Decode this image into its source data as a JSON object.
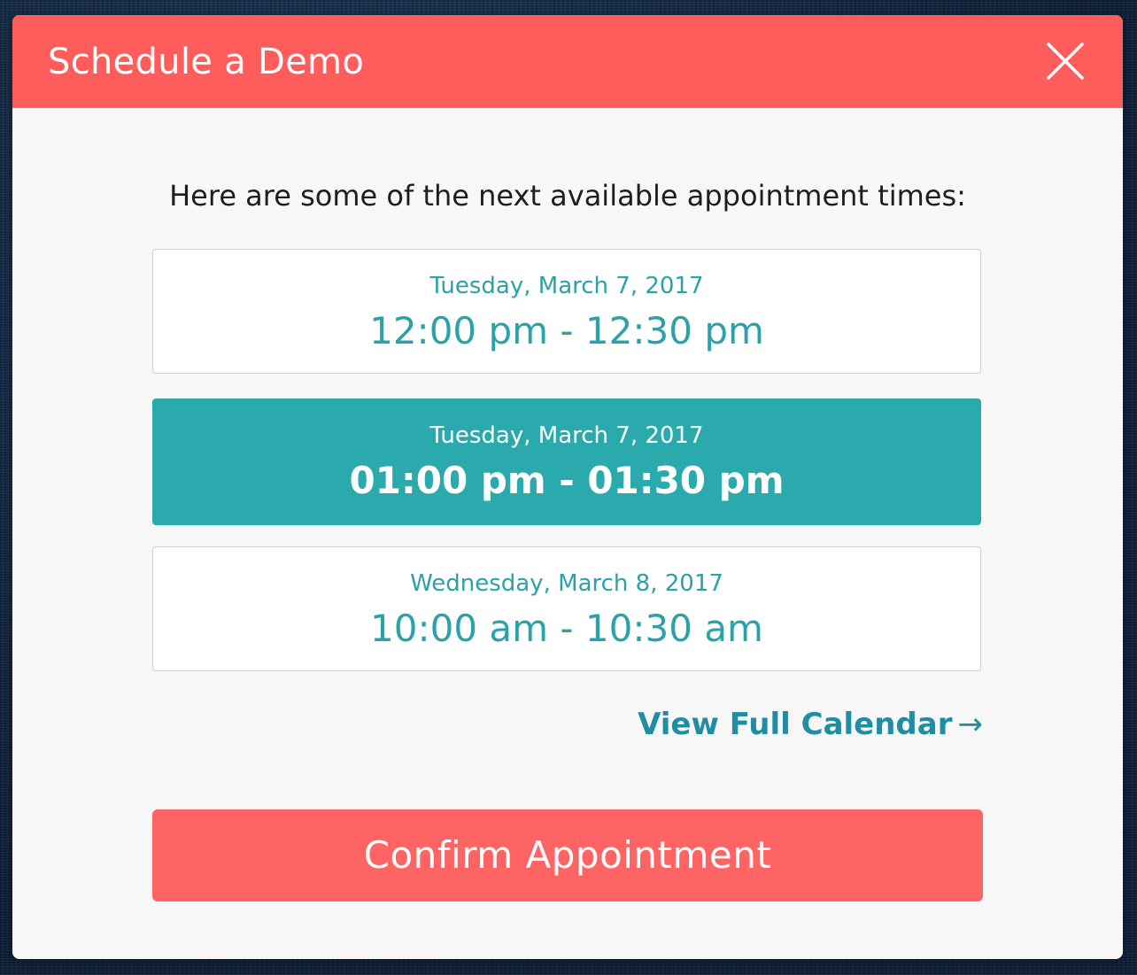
{
  "modal": {
    "title": "Schedule a Demo",
    "close_icon": "close-x-icon",
    "intro": "Here are some of the next available appointment times:",
    "slots": [
      {
        "date": "Tuesday, March 7, 2017",
        "time": "12:00 pm - 12:30 pm",
        "selected": false
      },
      {
        "date": "Tuesday, March 7, 2017",
        "time": "01:00 pm - 01:30 pm",
        "selected": true
      },
      {
        "date": "Wednesday, March 8, 2017",
        "time": "10:00 am - 10:30 am",
        "selected": false
      }
    ],
    "calendar_link": "View Full Calendar",
    "calendar_link_icon": "arrow-right-icon",
    "confirm_label": "Confirm Appointment"
  },
  "colors": {
    "header": "#ff5c5c",
    "accent_teal": "#2baaae",
    "confirm_button": "#ff6464",
    "background": "#13263e"
  }
}
